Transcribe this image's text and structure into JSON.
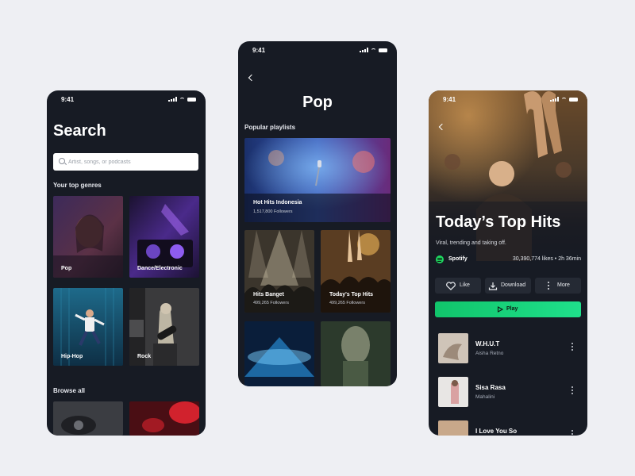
{
  "search_screen": {
    "time": "9:41",
    "title": "Search",
    "search_placeholder": "Artist, songs, or podcasts",
    "top_genres_label": "Your top genres",
    "genres": [
      "Pop",
      "Dance/Electronic",
      "Hip-Hop",
      "Rock"
    ],
    "browse_all_label": "Browse all"
  },
  "pop_screen": {
    "time": "9:41",
    "title": "Pop",
    "section_label": "Popular playlists",
    "playlists": [
      {
        "title": "Hot Hits Indonesia",
        "followers": "1,517,800 Followers"
      },
      {
        "title": "Hits Banget",
        "followers": "499,265 Followers"
      },
      {
        "title": "Today's Top Hits",
        "followers": "499,265 Followers"
      }
    ]
  },
  "playlist_screen": {
    "time": "9:41",
    "title": "Today’s Top Hits",
    "subtitle": "Viral, trending and taking off.",
    "source": "Spotify",
    "stats": "30,390,774 likes • 2h 36min",
    "actions": {
      "like": "Like",
      "download": "Download",
      "more": "More"
    },
    "play_label": "Play",
    "tracks": [
      {
        "title": "W.H.U.T",
        "artist": "Aisha Retno"
      },
      {
        "title": "Sisa Rasa",
        "artist": "Mahalini"
      },
      {
        "title": "I Love You So",
        "artist": ""
      }
    ]
  },
  "colors": {
    "background": "#eeeff3",
    "phone": "#171b24",
    "accent": "#1ed760"
  }
}
